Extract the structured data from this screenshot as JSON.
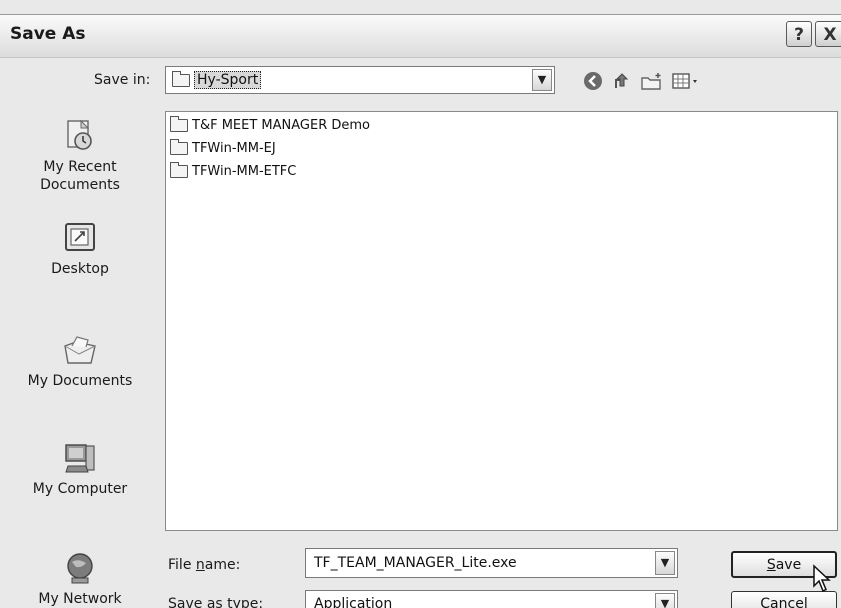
{
  "window": {
    "title": "Save As",
    "help_label": "?",
    "close_label": "X"
  },
  "save_in": {
    "label": "Save in:",
    "value": "Hy-Sport"
  },
  "places": [
    {
      "label_line1": "My Recent",
      "label_line2": "Documents",
      "icon": "recent-documents-icon"
    },
    {
      "label_line1": "Desktop",
      "label_line2": "",
      "icon": "desktop-icon"
    },
    {
      "label_line1": "My Documents",
      "label_line2": "",
      "icon": "my-documents-icon"
    },
    {
      "label_line1": "My Computer",
      "label_line2": "",
      "icon": "my-computer-icon"
    },
    {
      "label_line1": "My Network",
      "label_line2": "",
      "icon": "my-network-icon"
    }
  ],
  "files": [
    {
      "name": "T&F MEET MANAGER Demo"
    },
    {
      "name": "TFWin-MM-EJ"
    },
    {
      "name": "TFWin-MM-ETFC"
    }
  ],
  "file_name": {
    "label_pre": "File ",
    "label_underline": "n",
    "label_post": "ame:",
    "value": "TF_TEAM_MANAGER_Lite.exe"
  },
  "save_as_type": {
    "label": "Save as type:",
    "value": "Application"
  },
  "buttons": {
    "save_underline": "S",
    "save_rest": "ave",
    "cancel": "Cancel"
  }
}
